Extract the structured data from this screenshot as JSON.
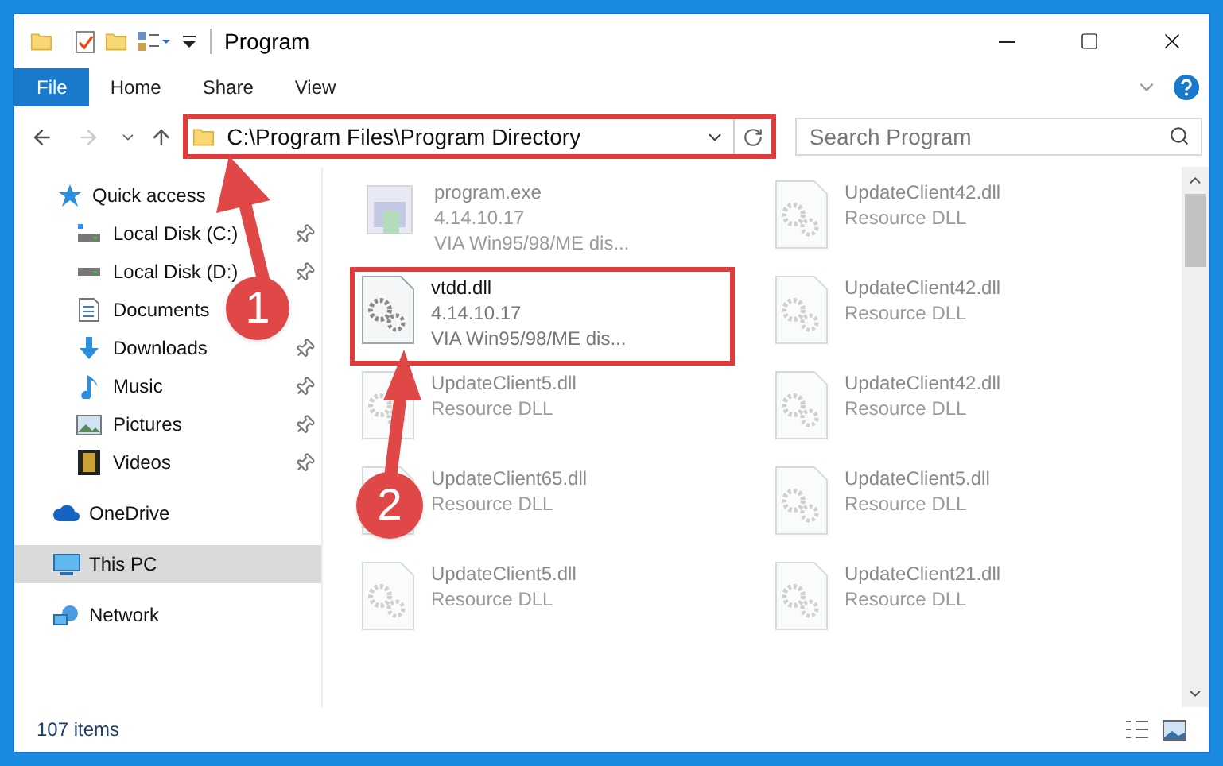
{
  "window": {
    "title": "Program"
  },
  "ribbon_tabs": [
    {
      "label": "File",
      "selected": true
    },
    {
      "label": "Home",
      "selected": false
    },
    {
      "label": "Share",
      "selected": false
    },
    {
      "label": "View",
      "selected": false
    }
  ],
  "address": {
    "path": "C:\\Program Files\\Program Directory",
    "highlighted": true
  },
  "search": {
    "placeholder": "Search Program"
  },
  "sidebar": {
    "items": [
      {
        "label": "Quick access",
        "selected": false,
        "children": [
          {
            "label": "Local Disk (C:)",
            "pinned": true
          },
          {
            "label": "Local Disk (D:)",
            "pinned": true
          },
          {
            "label": "Documents",
            "pinned": false
          },
          {
            "label": "Downloads",
            "pinned": true
          },
          {
            "label": "Music",
            "pinned": true
          },
          {
            "label": "Pictures",
            "pinned": true
          },
          {
            "label": "Videos",
            "pinned": true
          }
        ]
      },
      {
        "label": "OneDrive",
        "selected": false
      },
      {
        "label": "This PC",
        "selected": true
      },
      {
        "label": "Network",
        "selected": false
      }
    ]
  },
  "files": [
    {
      "kind": "exe",
      "name": "program.exe",
      "lines": [
        "4.14.10.17",
        "VIA Win95/98/ME dis..."
      ],
      "blurred": true,
      "highlighted": false
    },
    {
      "kind": "dll",
      "name": "UpdateClient42.dll",
      "lines": [
        "Resource DLL"
      ],
      "blurred": true,
      "highlighted": false
    },
    {
      "kind": "dll",
      "name": "vtdd.dll",
      "lines": [
        "4.14.10.17",
        "VIA Win95/98/ME dis..."
      ],
      "blurred": false,
      "highlighted": true
    },
    {
      "kind": "dll",
      "name": "UpdateClient42.dll",
      "lines": [
        "Resource DLL"
      ],
      "blurred": true,
      "highlighted": false
    },
    {
      "kind": "dll",
      "name": "UpdateClient5.dll",
      "lines": [
        "Resource DLL"
      ],
      "blurred": true,
      "highlighted": false
    },
    {
      "kind": "dll",
      "name": "UpdateClient42.dll",
      "lines": [
        "Resource DLL"
      ],
      "blurred": true,
      "highlighted": false
    },
    {
      "kind": "dll",
      "name": "UpdateClient65.dll",
      "lines": [
        "Resource DLL"
      ],
      "blurred": true,
      "highlighted": false
    },
    {
      "kind": "dll",
      "name": "UpdateClient5.dll",
      "lines": [
        "Resource DLL"
      ],
      "blurred": true,
      "highlighted": false
    },
    {
      "kind": "dll",
      "name": "UpdateClient5.dll",
      "lines": [
        "Resource DLL"
      ],
      "blurred": true,
      "highlighted": false
    },
    {
      "kind": "dll",
      "name": "UpdateClient21.dll",
      "lines": [
        "Resource DLL"
      ],
      "blurred": true,
      "highlighted": false
    }
  ],
  "status_bar": {
    "count": "107 items"
  },
  "callouts": [
    {
      "number": "1"
    },
    {
      "number": "2"
    }
  ]
}
